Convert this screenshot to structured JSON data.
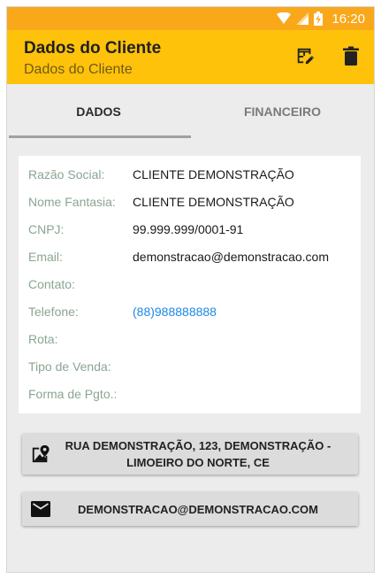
{
  "status_bar": {
    "time": "16:20",
    "icons": [
      "wifi-icon",
      "signal-icon",
      "battery-charging-icon"
    ]
  },
  "app_bar": {
    "title": "Dados do Cliente",
    "subtitle": "Dados do Cliente",
    "actions": [
      "edit-table-icon",
      "delete-icon"
    ],
    "colors": {
      "app_bar": "#fec20b",
      "status_bar": "#f9a81a"
    }
  },
  "tabs": [
    {
      "label": "DADOS",
      "active": true
    },
    {
      "label": "FINANCEIRO",
      "active": false
    }
  ],
  "fields": [
    {
      "label": "Razão Social:",
      "value": "CLIENTE DEMONSTRAÇÃO"
    },
    {
      "label": "Nome Fantasia:",
      "value": "CLIENTE DEMONSTRAÇÃO"
    },
    {
      "label": "CNPJ:",
      "value": "99.999.999/0001-91"
    },
    {
      "label": "Email:",
      "value": "demonstracao@demonstracao.com"
    },
    {
      "label": "Contato:",
      "value": ""
    },
    {
      "label": "Telefone:",
      "value": "(88)988888888"
    },
    {
      "label": "Rota:",
      "value": ""
    },
    {
      "label": "Tipo de Venda:",
      "value": ""
    },
    {
      "label": "Forma de Pgto.:",
      "value": ""
    }
  ],
  "address_button": {
    "line1": "RUA DEMONSTRAÇÃO, 123, DEMONSTRAÇÃO -",
    "line2": "LIMOEIRO DO NORTE, CE",
    "icon": "map-pin-icon"
  },
  "email_button": {
    "label": "DEMONSTRACAO@DEMONSTRACAO.COM",
    "icon": "mail-icon"
  },
  "colors": {
    "label": "#8aa592",
    "link": "#1e88e5"
  }
}
